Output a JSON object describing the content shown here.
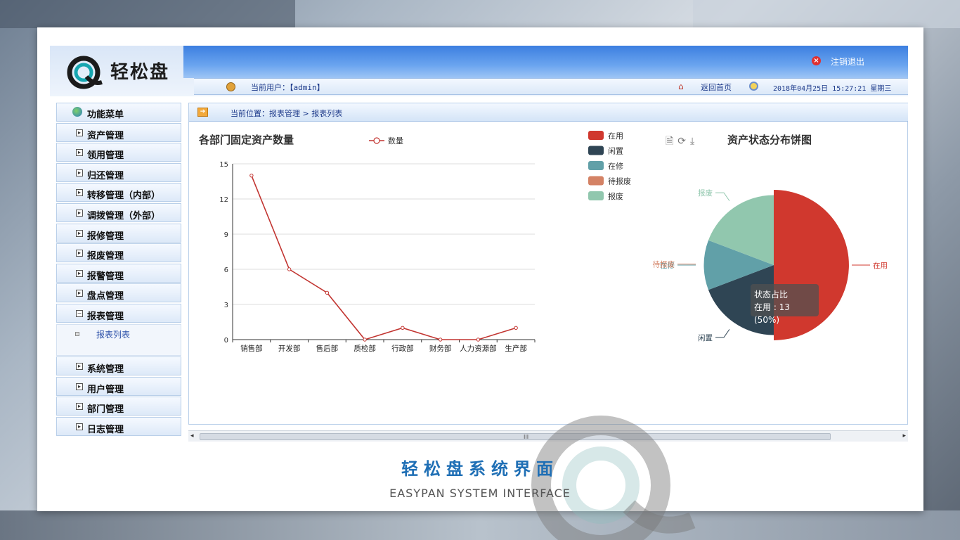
{
  "brand": {
    "name": "轻松盘"
  },
  "header": {
    "logout_label": "注销退出",
    "current_user": "当前用户：【admin】",
    "home_label": "返回首页",
    "datetime": "2018年04月25日 15:27:21 星期三"
  },
  "sidebar": {
    "title": "功能菜单",
    "items": [
      {
        "label": "资产管理",
        "expanded": false
      },
      {
        "label": "领用管理",
        "expanded": false
      },
      {
        "label": "归还管理",
        "expanded": false
      },
      {
        "label": "转移管理（内部）",
        "expanded": false
      },
      {
        "label": "调拨管理（外部）",
        "expanded": false
      },
      {
        "label": "报修管理",
        "expanded": false
      },
      {
        "label": "报废管理",
        "expanded": false
      },
      {
        "label": "报警管理",
        "expanded": false
      },
      {
        "label": "盘点管理",
        "expanded": false
      },
      {
        "label": "报表管理",
        "expanded": true
      },
      {
        "label": "系统管理",
        "expanded": false
      },
      {
        "label": "用户管理",
        "expanded": false
      },
      {
        "label": "部门管理",
        "expanded": false
      },
      {
        "label": "日志管理",
        "expanded": false
      }
    ],
    "submenu": {
      "label": "报表列表"
    },
    "expanded_box": "−",
    "collapsed_box": "▸"
  },
  "breadcrumb": {
    "text": "当前位置：报表管理 > 报表列表"
  },
  "chart_data": [
    {
      "type": "line",
      "title": "各部门固定资产数量",
      "categories": [
        "销售部",
        "开发部",
        "售后部",
        "质检部",
        "行政部",
        "财务部",
        "人力资源部",
        "生产部"
      ],
      "series": [
        {
          "name": "数量",
          "values": [
            14,
            6,
            4,
            0,
            1,
            0,
            0,
            1
          ],
          "color": "#c23531"
        }
      ],
      "ylim": [
        0,
        15
      ],
      "yticks": [
        0,
        3,
        6,
        9,
        12,
        15
      ],
      "grid": true,
      "legend_position": "top"
    },
    {
      "type": "pie",
      "title": "资产状态分布饼图",
      "series_name": "状态占比",
      "labels": [
        "在用",
        "闲置",
        "在修",
        "待报废",
        "报废"
      ],
      "values": [
        13,
        5,
        3,
        0,
        5
      ],
      "colors": [
        "#d0382e",
        "#2f4554",
        "#61a0a8",
        "#d48265",
        "#91c7ae"
      ],
      "legend_position": "left"
    }
  ],
  "tooltip": {
    "title": "状态占比",
    "text": "在用 : 13 (50%)"
  },
  "toolbox": {
    "icons": [
      "data-view-icon",
      "refresh-icon",
      "download-icon"
    ]
  },
  "footer": {
    "title": "轻松盘系统界面",
    "subtitle": "EASYPAN SYSTEM INTERFACE"
  },
  "scroll": {
    "grip": "III",
    "left": "◂",
    "right": "▸"
  }
}
